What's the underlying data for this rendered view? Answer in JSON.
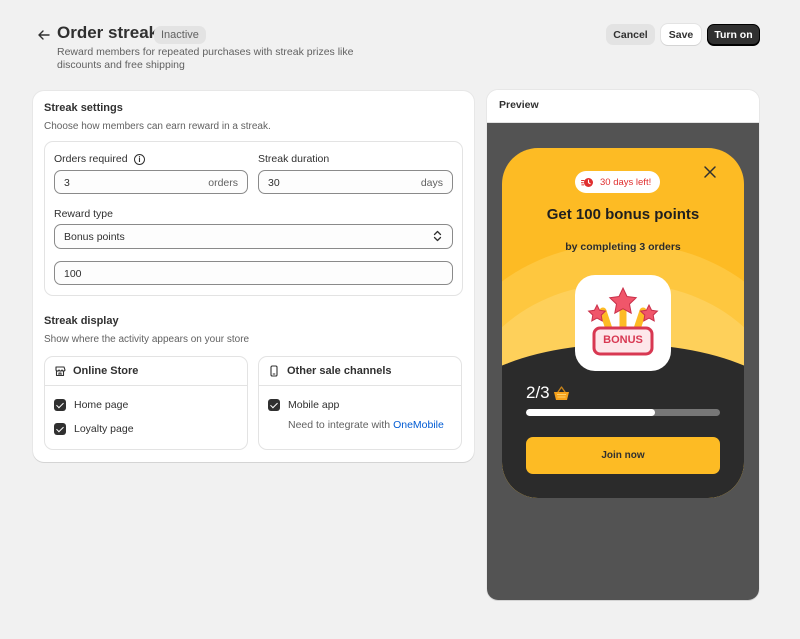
{
  "header": {
    "title": "Order streak",
    "status_badge": "Inactive",
    "subtitle": "Reward members for repeated purchases with streak prizes like discounts and free shipping",
    "cancel_label": "Cancel",
    "save_label": "Save",
    "turn_on_label": "Turn on"
  },
  "streak_settings": {
    "title": "Streak settings",
    "subtitle": "Choose how members can earn reward in a streak.",
    "orders_required": {
      "label": "Orders required",
      "value": "3",
      "suffix": "orders"
    },
    "streak_duration": {
      "label": "Streak duration",
      "value": "30",
      "suffix": "days"
    },
    "reward_type": {
      "label": "Reward type",
      "selected": "Bonus points"
    },
    "reward_amount": {
      "value": "100"
    }
  },
  "streak_display": {
    "title": "Streak display",
    "subtitle": "Show where the activity appears on your store",
    "online_store": {
      "title": "Online Store",
      "options": [
        {
          "label": "Home page",
          "checked": true
        },
        {
          "label": "Loyalty page",
          "checked": true
        }
      ]
    },
    "other_channels": {
      "title": "Other sale channels",
      "options": [
        {
          "label": "Mobile app",
          "checked": true
        }
      ],
      "integrate_text": "Need to integrate with",
      "integrate_link": "OneMobile"
    }
  },
  "preview": {
    "title": "Preview",
    "days_left": "30 days left!",
    "headline": "Get 100 bonus points",
    "subline": "by completing 3 orders",
    "badge_text": "BONUS",
    "progress_text": "2/3",
    "progress_fraction": 0.667,
    "join_label": "Join now"
  },
  "colors": {
    "accent_yellow": "#fdbb24",
    "dark": "#303030",
    "link": "#005bd3",
    "alert_red": "#e02f2f"
  }
}
